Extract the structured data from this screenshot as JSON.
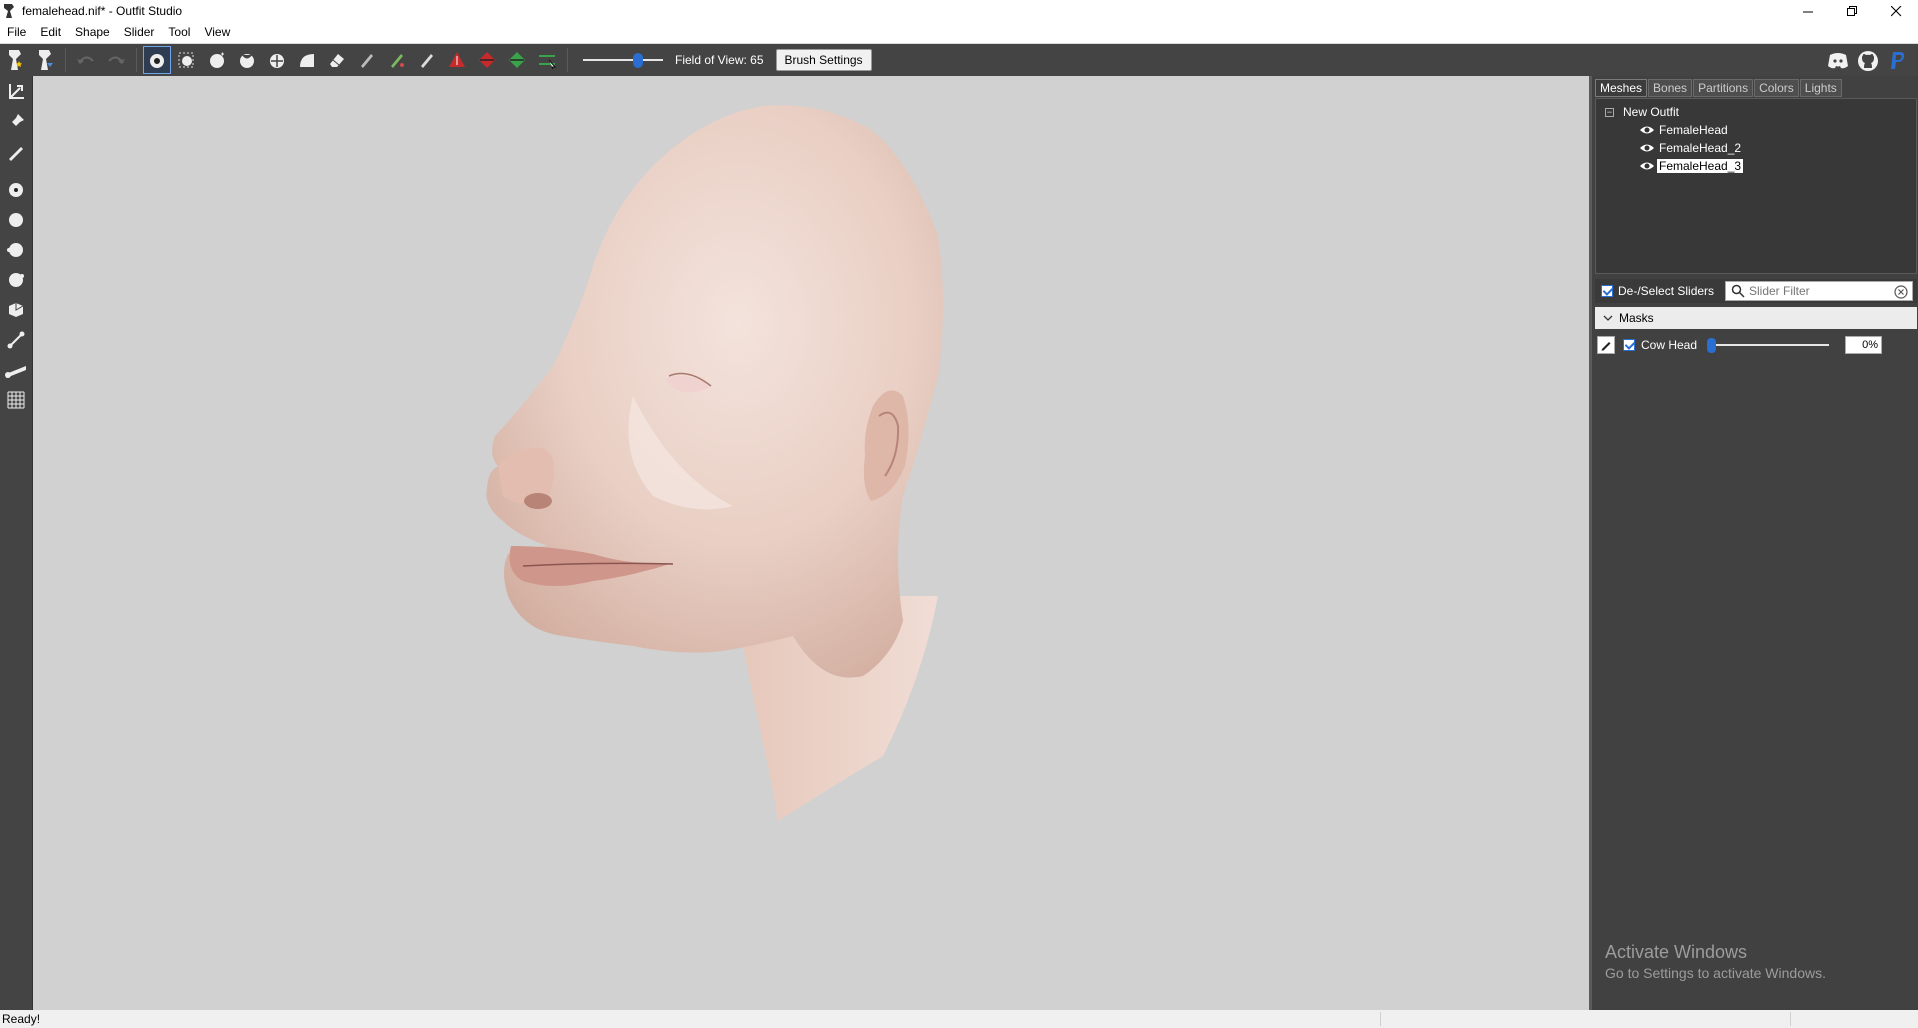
{
  "window": {
    "title": "femalehead.nif* - Outfit Studio",
    "controls": [
      "minimize",
      "maximize",
      "close"
    ]
  },
  "menu": [
    "File",
    "Edit",
    "Shape",
    "Slider",
    "Tool",
    "View"
  ],
  "toolbar": {
    "fov_label": "Field of View: 65",
    "fov_value": 65,
    "brush_settings": "Brush Settings"
  },
  "right_panel": {
    "tabs": [
      "Meshes",
      "Bones",
      "Partitions",
      "Colors",
      "Lights"
    ],
    "active_tab": "Meshes",
    "tree": {
      "root": "New Outfit",
      "items": [
        "FemaleHead",
        "FemaleHead_2",
        "FemaleHead_3"
      ],
      "selected": "FemaleHead_3"
    },
    "deselect_label": "De-/Select Sliders",
    "slider_filter_placeholder": "Slider Filter",
    "masks_label": "Masks",
    "sliders": [
      {
        "name": "Cow Head",
        "value": "0%",
        "fraction": 0
      }
    ]
  },
  "watermark": {
    "line1": "Activate Windows",
    "line2": "Go to Settings to activate Windows."
  },
  "status": "Ready!",
  "colors": {
    "accent": "#2a6ed1",
    "toolbar_bg": "#444444",
    "viewport_bg": "#d1d1d1",
    "panel_bg": "#414141"
  }
}
